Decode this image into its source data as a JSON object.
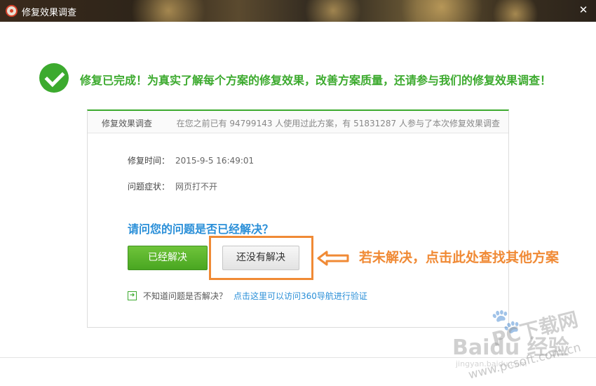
{
  "window": {
    "title": "修复效果调查",
    "close_glyph": "✕"
  },
  "header": {
    "message": "修复已完成！为真实了解每个方案的修复效果，改善方案质量，还请参与我们的修复效果调查！"
  },
  "panel": {
    "title": "修复效果调查",
    "stats": "在您之前已有 94799143 人使用过此方案，有 51831287 人参与了本次修复效果调查",
    "repair_time_label": "修复时间：",
    "repair_time_value": "2015-9-5 16:49:01",
    "symptom_label": "问题症状：",
    "symptom_value": "网页打不开",
    "question": "请问您的问题是否已经解决？",
    "solved_button": "已经解决",
    "unsolved_button": "还没有解决",
    "hint_text": "不知道问题是否解决？",
    "hint_link": "点击这里可以访问360导航进行验证"
  },
  "annotation": {
    "callout": "若未解决，点击此处查找其他方案",
    "color": "#f08a35"
  },
  "watermark": {
    "baidu": "Baidu 经验",
    "pcsoft": "PC下载网",
    "url": "www.pcsoft.com.cn",
    "jingyan": "jingyan.baidu.com"
  },
  "colors": {
    "accent_green": "#3caa2e",
    "link_blue": "#2a8fd8"
  }
}
